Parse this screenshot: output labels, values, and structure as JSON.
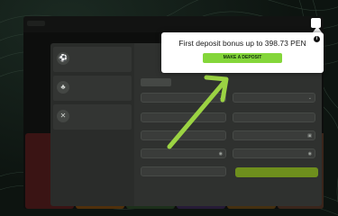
{
  "popup": {
    "title": "First deposit bonus up to 398.73 PEN",
    "cta": "MAKE A DEPOSIT",
    "info_icon": "info-icon"
  },
  "colors": {
    "accent": "#84d63a",
    "arrow": "#9bd343",
    "panel": "#2f312f"
  }
}
